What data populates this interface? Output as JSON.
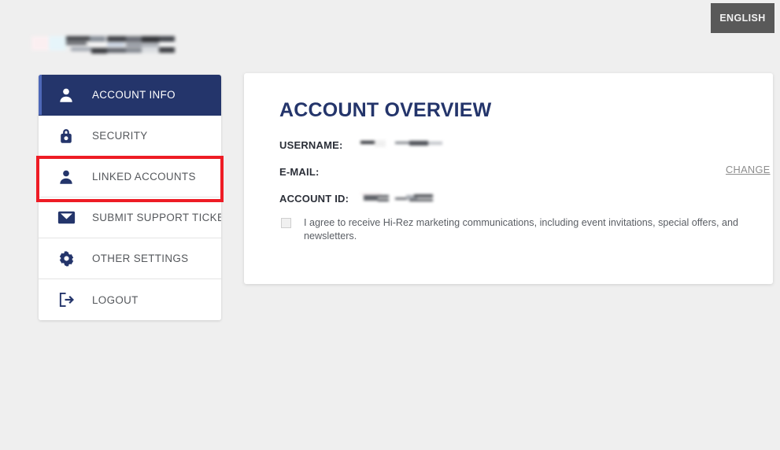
{
  "topbar": {
    "language_button_label": "ENGLISH",
    "language_button_color": "#595959",
    "logo_redacted": true
  },
  "sidebar": {
    "active_index": 0,
    "active_color": "#24356b",
    "accent_color": "#4e68b8",
    "items": [
      {
        "label": "ACCOUNT INFO",
        "icon": "person-icon",
        "active": true
      },
      {
        "label": "SECURITY",
        "icon": "lock-icon",
        "active": false
      },
      {
        "label": "LINKED ACCOUNTS",
        "icon": "person-icon",
        "active": false
      },
      {
        "label": "SUBMIT SUPPORT TICKET",
        "icon": "envelope-icon",
        "active": false
      },
      {
        "label": "OTHER SETTINGS",
        "icon": "gear-icon",
        "active": false
      },
      {
        "label": "LOGOUT",
        "icon": "logout-icon",
        "active": false
      }
    ]
  },
  "annotation": {
    "target_item": "LINKED ACCOUNTS",
    "box_color": "#ee1c25"
  },
  "main": {
    "title": "ACCOUNT OVERVIEW",
    "title_color": "#24356b",
    "fields": [
      {
        "label": "USERNAME:",
        "value": "",
        "redacted": true
      },
      {
        "label": "E-MAIL:",
        "value": "",
        "redacted": false
      },
      {
        "label": "ACCOUNT ID:",
        "value": "",
        "redacted": true
      }
    ],
    "change_link_label": "CHANGE",
    "consent": {
      "checked": false,
      "text": "I agree to receive Hi-Rez marketing communications, including event invitations, special offers, and newsletters."
    }
  }
}
